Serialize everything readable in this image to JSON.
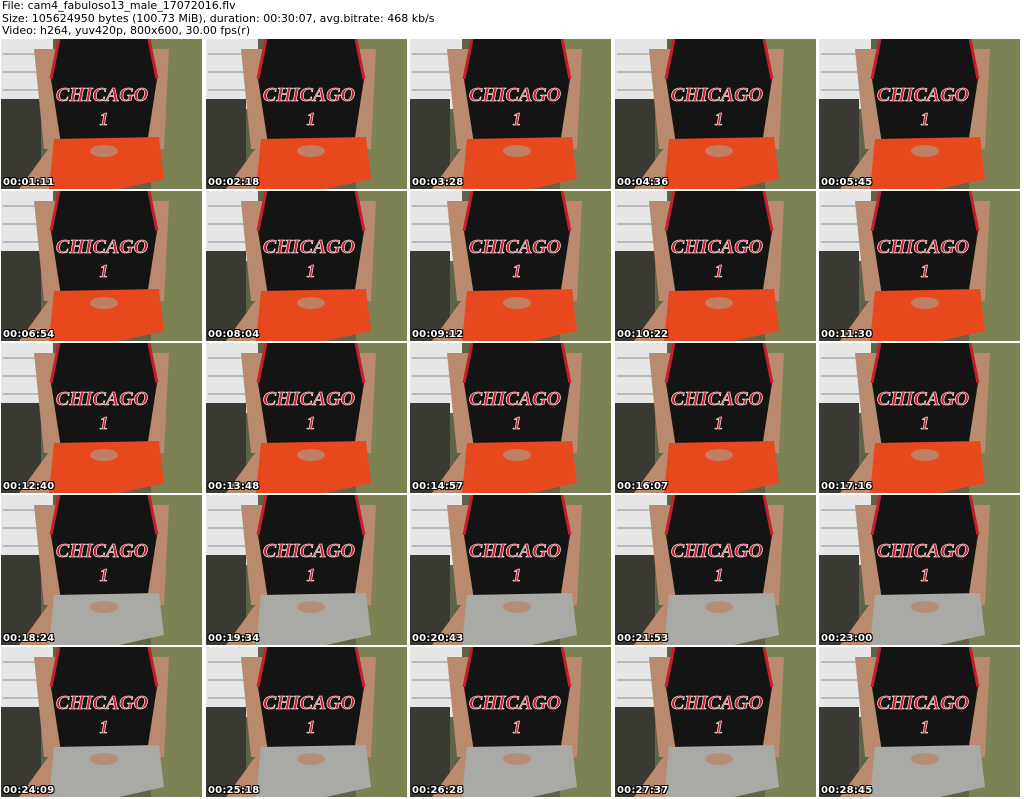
{
  "header": {
    "line1": "File: cam4_fabuloso13_male_17072016.flv",
    "line2": "Size: 105624950 bytes (100.73 MiB), duration: 00:30:07, avg.bitrate: 468 kb/s",
    "line3": "Video: h264, yuv420p, 800x600, 30.00 fps(r)"
  },
  "thumbnails": [
    {
      "time": "00:01:11",
      "shorts": "orange"
    },
    {
      "time": "00:02:18",
      "shorts": "orange"
    },
    {
      "time": "00:03:28",
      "shorts": "orange"
    },
    {
      "time": "00:04:36",
      "shorts": "orange"
    },
    {
      "time": "00:05:45",
      "shorts": "orange"
    },
    {
      "time": "00:06:54",
      "shorts": "orange"
    },
    {
      "time": "00:08:04",
      "shorts": "orange"
    },
    {
      "time": "00:09:12",
      "shorts": "orange"
    },
    {
      "time": "00:10:22",
      "shorts": "orange"
    },
    {
      "time": "00:11:30",
      "shorts": "orange"
    },
    {
      "time": "00:12:40",
      "shorts": "orange"
    },
    {
      "time": "00:13:48",
      "shorts": "orange"
    },
    {
      "time": "00:14:57",
      "shorts": "orange"
    },
    {
      "time": "00:16:07",
      "shorts": "orange"
    },
    {
      "time": "00:17:16",
      "shorts": "orange"
    },
    {
      "time": "00:18:24",
      "shorts": "gray"
    },
    {
      "time": "00:19:34",
      "shorts": "gray"
    },
    {
      "time": "00:20:43",
      "shorts": "gray"
    },
    {
      "time": "00:21:53",
      "shorts": "gray"
    },
    {
      "time": "00:23:00",
      "shorts": "gray"
    },
    {
      "time": "00:24:09",
      "shorts": "gray"
    },
    {
      "time": "00:25:18",
      "shorts": "gray"
    },
    {
      "time": "00:26:28",
      "shorts": "gray"
    },
    {
      "time": "00:27:37",
      "shorts": "gray"
    },
    {
      "time": "00:28:45",
      "shorts": "gray"
    }
  ],
  "jersey_text": "CHICAGO",
  "jersey_number": "1",
  "colors": {
    "jersey": "#141414",
    "jersey_trim": "#c4202b",
    "orange_shorts": "#e8481e",
    "gray_shorts": "#a9a9a6",
    "skin": "#b98a6e",
    "background_chair": "#5f6448",
    "dresser": "#e6e6e6"
  }
}
